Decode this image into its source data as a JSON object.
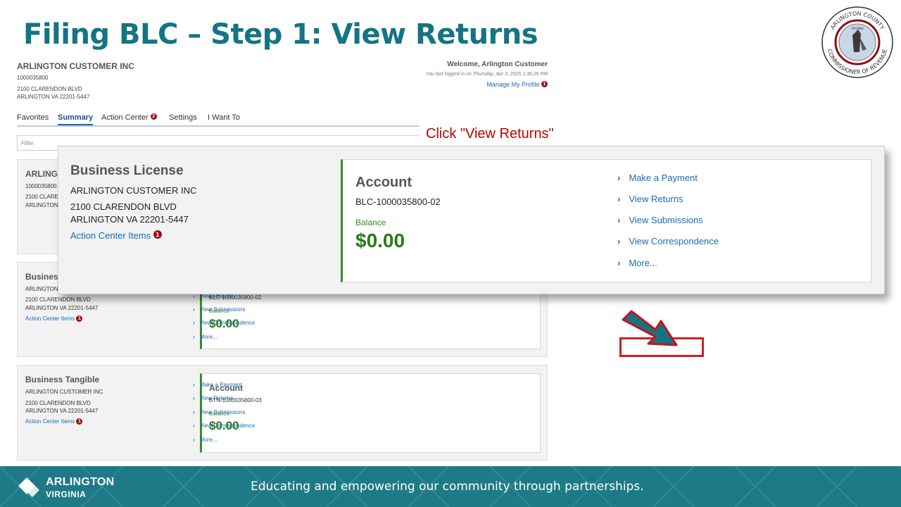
{
  "slide": {
    "title": "Filing BLC – Step 1:  View Returns",
    "callout": "Click \"View Returns\"",
    "seal_text_top": "ARLINGTON COUNTY",
    "seal_text_bottom": "COMMISSIONER OF REVENUE",
    "seal_text_center": "VIRGINIA"
  },
  "account": {
    "name": "ARLINGTON CUSTOMER INC",
    "id": "1000035800",
    "address1": "2100 CLARENDON BLVD",
    "address2": "ARLINGTON VA 22201-5447"
  },
  "header": {
    "welcome": "Welcome, Arlington Customer",
    "last_login": "You last logged in on Thursday, Apr 3, 2025 1:36:25 PM",
    "manage_profile": "Manage My Profile",
    "profile_badge": "1"
  },
  "tabs": [
    {
      "label": "Favorites"
    },
    {
      "label": "Summary"
    },
    {
      "label": "Action Center",
      "badge": "2"
    },
    {
      "label": "Settings"
    },
    {
      "label": "I Want To"
    }
  ],
  "filter": {
    "placeholder": "Filter"
  },
  "cards": {
    "first": {
      "title_partial": "ARLING",
      "id_partial": "1000035800",
      "addr1_partial": "2100 CLARE",
      "addr2_partial": "ARLINGTON"
    },
    "second": {
      "title_partial": "Busines",
      "name_partial": "ARLINGTON",
      "address1": "2100 CLARENDON BLVD",
      "address2": "ARLINGTON VA 22201-5447",
      "action_center": "Action Center Items",
      "badge": "1",
      "account_id": "BLC-1000035800-02",
      "balance_label": "Balance",
      "balance": "$0.00",
      "links": [
        "View Returns",
        "View Submissions",
        "View Correspondence",
        "More..."
      ]
    },
    "third": {
      "title": "Business Tangible",
      "name": "ARLINGTON CUSTOMER INC",
      "address1": "2100 CLARENDON BLVD",
      "address2": "ARLINGTON VA 22201-5447",
      "action_center": "Action Center Items",
      "badge": "1",
      "account_title": "Account",
      "account_id": "BTN-1000035800-03",
      "balance_label": "Balance",
      "balance": "$0.00",
      "links": [
        "Make a Payment",
        "View Returns",
        "View Submissions",
        "View Correspondence",
        "More..."
      ]
    }
  },
  "zoom": {
    "title": "Business License",
    "name": "ARLINGTON CUSTOMER INC",
    "address1": "2100 CLARENDON BLVD",
    "address2": "ARLINGTON VA 22201-5447",
    "action_center": "Action Center Items",
    "badge": "1",
    "account_title": "Account",
    "account_id": "BLC-1000035800-02",
    "balance_label": "Balance",
    "balance": "$0.00",
    "links": [
      "Make a Payment",
      "View Returns",
      "View Submissions",
      "View Correspondence",
      "More..."
    ]
  },
  "footer": {
    "logo_line1": "ARLINGTON",
    "logo_line2": "VIRGINIA",
    "tagline": "Educating and empowering our community through partnerships."
  },
  "colors": {
    "title": "#157483",
    "footer": "#1e7a86",
    "link": "#1a6ab0",
    "balance": "#2a7a1a",
    "highlight": "#d41d1d",
    "arrow": "#157483"
  }
}
